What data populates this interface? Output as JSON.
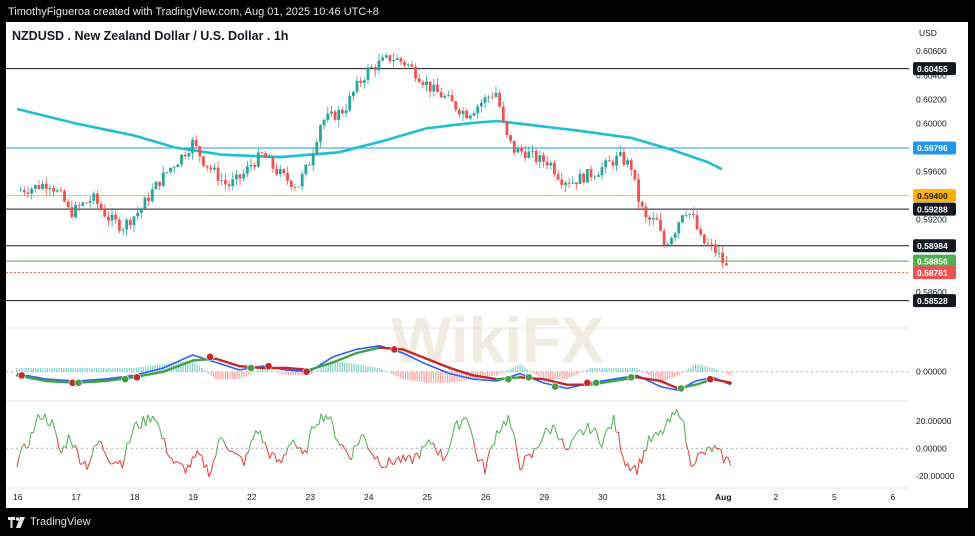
{
  "header": {
    "attribution": "TimothyFigueroa created with TradingView.com, Aug 01, 2025 10:46 UTC+8"
  },
  "chart_title": "NZDUSD . New Zealand Dollar / U.S. Dollar . 1h",
  "footer": {
    "brand": "TradingView"
  },
  "watermark": {
    "text": "WikiFX"
  },
  "colors": {
    "up": "#26a69a",
    "down": "#ef5350",
    "ma": "#1fbfcf",
    "macd_line": "#2962ff",
    "signal_line": "#c62828",
    "signal_up": "#43a047",
    "osc_up": "#4caf50",
    "osc_down": "#e53935",
    "res_black": "#131722",
    "res_blue": "#2196f3",
    "res_orange": "#ffb300",
    "res_green": "#4caf50",
    "res_red": "#ef5350"
  },
  "chart_data": [
    {
      "type": "candlestick",
      "title": "NZDUSD . New Zealand Dollar / U.S. Dollar . 1h",
      "yunit": "USD",
      "ylim": [
        0.5845,
        0.6066
      ],
      "yticks": [
        "0.60600",
        "0.60400",
        "0.60200",
        "0.60000",
        "0.59600",
        "0.59200",
        "0.58600"
      ],
      "xticks": [
        "16",
        "17",
        "18",
        "19",
        "22",
        "23",
        "24",
        "25",
        "26",
        "29",
        "30",
        "31",
        "Aug",
        "2",
        "5",
        "6"
      ],
      "price_path": [
        [
          0.0,
          0.5944
        ],
        [
          0.3,
          0.5947
        ],
        [
          0.55,
          0.5951
        ],
        [
          0.8,
          0.5936
        ],
        [
          0.9,
          0.5925
        ],
        [
          1.1,
          0.5932
        ],
        [
          1.3,
          0.5938
        ],
        [
          1.55,
          0.5922
        ],
        [
          1.8,
          0.5914
        ],
        [
          2.1,
          0.5928
        ],
        [
          2.4,
          0.595
        ],
        [
          2.6,
          0.5962
        ],
        [
          2.8,
          0.5972
        ],
        [
          3.0,
          0.5984
        ],
        [
          3.2,
          0.5968
        ],
        [
          3.4,
          0.5958
        ],
        [
          3.6,
          0.5948
        ],
        [
          3.85,
          0.5956
        ],
        [
          4.0,
          0.5966
        ],
        [
          4.2,
          0.5974
        ],
        [
          4.4,
          0.5962
        ],
        [
          4.6,
          0.5954
        ],
        [
          4.8,
          0.5948
        ],
        [
          5.0,
          0.5968
        ],
        [
          5.2,
          0.6002
        ],
        [
          5.4,
          0.6006
        ],
        [
          5.6,
          0.6012
        ],
        [
          5.8,
          0.603
        ],
        [
          6.0,
          0.6044
        ],
        [
          6.2,
          0.605
        ],
        [
          6.4,
          0.6055
        ],
        [
          6.55,
          0.6052
        ],
        [
          6.7,
          0.6048
        ],
        [
          6.9,
          0.6038
        ],
        [
          7.1,
          0.6028
        ],
        [
          7.3,
          0.6022
        ],
        [
          7.5,
          0.6014
        ],
        [
          7.7,
          0.6008
        ],
        [
          7.9,
          0.6016
        ],
        [
          8.1,
          0.6024
        ],
        [
          8.2,
          0.6026
        ],
        [
          8.35,
          0.599
        ],
        [
          8.5,
          0.5978
        ],
        [
          8.7,
          0.5976
        ],
        [
          8.9,
          0.597
        ],
        [
          9.1,
          0.5968
        ],
        [
          9.3,
          0.5954
        ],
        [
          9.5,
          0.5952
        ],
        [
          9.7,
          0.5956
        ],
        [
          9.9,
          0.596
        ],
        [
          10.1,
          0.5966
        ],
        [
          10.3,
          0.5972
        ],
        [
          10.5,
          0.5964
        ],
        [
          10.6,
          0.594
        ],
        [
          10.75,
          0.592
        ],
        [
          10.95,
          0.5918
        ],
        [
          11.05,
          0.5898
        ],
        [
          11.25,
          0.5912
        ],
        [
          11.4,
          0.593
        ],
        [
          11.55,
          0.5922
        ],
        [
          11.7,
          0.5902
        ],
        [
          11.9,
          0.5896
        ],
        [
          12.0,
          0.589
        ],
        [
          12.15,
          0.5878
        ]
      ],
      "moving_average": [
        [
          0.0,
          0.6012
        ],
        [
          1.0,
          0.6
        ],
        [
          2.0,
          0.599
        ],
        [
          2.7,
          0.598
        ],
        [
          3.5,
          0.5974
        ],
        [
          4.5,
          0.5972
        ],
        [
          5.5,
          0.5976
        ],
        [
          6.3,
          0.5986
        ],
        [
          7.0,
          0.5996
        ],
        [
          7.7,
          0.6
        ],
        [
          8.2,
          0.6002
        ],
        [
          8.9,
          0.5998
        ],
        [
          9.6,
          0.5994
        ],
        [
          10.5,
          0.5988
        ],
        [
          11.2,
          0.5978
        ],
        [
          11.8,
          0.5968
        ],
        [
          12.05,
          0.5962
        ]
      ],
      "horizontal_levels": [
        {
          "price": 0.60455,
          "label": "0.60455",
          "color_key": "res_black"
        },
        {
          "price": 0.59796,
          "label": "0.59796",
          "color_key": "res_blue"
        },
        {
          "price": 0.594,
          "label": "0.59400",
          "color_key": "res_orange"
        },
        {
          "price": 0.59288,
          "label": "0.59288",
          "color_key": "res_black"
        },
        {
          "price": 0.58984,
          "label": "0.58984",
          "color_key": "res_black"
        },
        {
          "price": 0.58856,
          "label": "0.58856",
          "color_key": "res_green"
        },
        {
          "price": 0.58761,
          "label": "0.58761",
          "color_key": "res_red"
        },
        {
          "price": 0.58528,
          "label": "0.58528",
          "color_key": "res_black"
        }
      ]
    },
    {
      "type": "line",
      "indicator": "MACD",
      "ylim": [
        -0.0012,
        0.0016
      ],
      "yticks": [
        "0.00000"
      ],
      "macd": [
        [
          0.0,
          -0.0001
        ],
        [
          0.5,
          -0.0004
        ],
        [
          1.0,
          -0.0005
        ],
        [
          1.5,
          -0.0004
        ],
        [
          2.0,
          -0.0002
        ],
        [
          2.5,
          0.0002
        ],
        [
          3.0,
          0.0009
        ],
        [
          3.4,
          0.0005
        ],
        [
          3.8,
          0.0001
        ],
        [
          4.2,
          0.0003
        ],
        [
          4.6,
          0.0001
        ],
        [
          5.0,
          0.0
        ],
        [
          5.4,
          0.0008
        ],
        [
          5.8,
          0.0012
        ],
        [
          6.2,
          0.0014
        ],
        [
          6.6,
          0.001
        ],
        [
          7.0,
          0.0004
        ],
        [
          7.4,
          -0.0001
        ],
        [
          7.8,
          -0.0004
        ],
        [
          8.2,
          -0.0005
        ],
        [
          8.6,
          -0.0001
        ],
        [
          9.0,
          -0.0006
        ],
        [
          9.4,
          -0.0009
        ],
        [
          9.8,
          -0.0006
        ],
        [
          10.2,
          -0.0004
        ],
        [
          10.6,
          -0.0002
        ],
        [
          11.0,
          -0.0008
        ],
        [
          11.3,
          -0.001
        ],
        [
          11.6,
          -0.0005
        ],
        [
          11.9,
          -0.0003
        ],
        [
          12.2,
          -0.0007
        ]
      ],
      "signal": [
        [
          0.0,
          -0.0002
        ],
        [
          0.5,
          -0.0005
        ],
        [
          1.0,
          -0.0006
        ],
        [
          1.5,
          -0.0005
        ],
        [
          2.0,
          -0.0003
        ],
        [
          2.5,
          0.0
        ],
        [
          3.0,
          0.0006
        ],
        [
          3.4,
          0.0007
        ],
        [
          3.8,
          0.0003
        ],
        [
          4.2,
          0.0002
        ],
        [
          4.6,
          0.0002
        ],
        [
          5.0,
          0.0001
        ],
        [
          5.4,
          0.0005
        ],
        [
          5.8,
          0.001
        ],
        [
          6.2,
          0.0013
        ],
        [
          6.6,
          0.0012
        ],
        [
          7.0,
          0.0007
        ],
        [
          7.4,
          0.0002
        ],
        [
          7.8,
          -0.0002
        ],
        [
          8.2,
          -0.0004
        ],
        [
          8.6,
          -0.0003
        ],
        [
          9.0,
          -0.0004
        ],
        [
          9.4,
          -0.0007
        ],
        [
          9.8,
          -0.0007
        ],
        [
          10.2,
          -0.0005
        ],
        [
          10.6,
          -0.0003
        ],
        [
          11.0,
          -0.0005
        ],
        [
          11.3,
          -0.0009
        ],
        [
          11.6,
          -0.0007
        ],
        [
          11.9,
          -0.0004
        ],
        [
          12.2,
          -0.0006
        ]
      ],
      "cross_markers": [
        {
          "x": 0.08,
          "y": -0.0002,
          "kind": "down"
        },
        {
          "x": 0.95,
          "y": -0.0006,
          "kind": "down"
        },
        {
          "x": 1.05,
          "y": -0.0006,
          "kind": "up"
        },
        {
          "x": 1.85,
          "y": -0.0004,
          "kind": "up"
        },
        {
          "x": 2.05,
          "y": -0.0003,
          "kind": "down"
        },
        {
          "x": 3.3,
          "y": 0.0008,
          "kind": "down"
        },
        {
          "x": 4.0,
          "y": 0.0002,
          "kind": "up"
        },
        {
          "x": 4.3,
          "y": 0.0003,
          "kind": "down"
        },
        {
          "x": 4.95,
          "y": 0.0,
          "kind": "down"
        },
        {
          "x": 6.45,
          "y": 0.0012,
          "kind": "down"
        },
        {
          "x": 8.4,
          "y": -0.0004,
          "kind": "up"
        },
        {
          "x": 8.75,
          "y": -0.0003,
          "kind": "up"
        },
        {
          "x": 9.2,
          "y": -0.0008,
          "kind": "up"
        },
        {
          "x": 9.75,
          "y": -0.0006,
          "kind": "down"
        },
        {
          "x": 9.9,
          "y": -0.0006,
          "kind": "up"
        },
        {
          "x": 10.5,
          "y": -0.0003,
          "kind": "up"
        },
        {
          "x": 11.35,
          "y": -0.0009,
          "kind": "up"
        },
        {
          "x": 11.85,
          "y": -0.0004,
          "kind": "down"
        }
      ]
    },
    {
      "type": "line",
      "indicator": "oscillator",
      "ylim": [
        -26,
        30
      ],
      "yticks": [
        "20.00000",
        "0.00000",
        "-20.00000"
      ],
      "values": [
        [
          0.0,
          -10
        ],
        [
          0.2,
          5
        ],
        [
          0.4,
          25
        ],
        [
          0.6,
          18
        ],
        [
          0.75,
          -5
        ],
        [
          0.9,
          10
        ],
        [
          1.05,
          -6
        ],
        [
          1.2,
          -12
        ],
        [
          1.4,
          5
        ],
        [
          1.6,
          -8
        ],
        [
          1.8,
          -10
        ],
        [
          2.0,
          15
        ],
        [
          2.2,
          20
        ],
        [
          2.35,
          25
        ],
        [
          2.5,
          5
        ],
        [
          2.7,
          -12
        ],
        [
          2.9,
          -15
        ],
        [
          3.1,
          -5
        ],
        [
          3.3,
          -18
        ],
        [
          3.5,
          10
        ],
        [
          3.7,
          -5
        ],
        [
          3.9,
          -10
        ],
        [
          4.1,
          15
        ],
        [
          4.3,
          -3
        ],
        [
          4.5,
          -12
        ],
        [
          4.7,
          8
        ],
        [
          4.9,
          -8
        ],
        [
          5.1,
          20
        ],
        [
          5.3,
          25
        ],
        [
          5.5,
          5
        ],
        [
          5.7,
          -6
        ],
        [
          5.9,
          10
        ],
        [
          6.1,
          -5
        ],
        [
          6.3,
          -12
        ],
        [
          6.5,
          -8
        ],
        [
          6.7,
          -10
        ],
        [
          6.9,
          -3
        ],
        [
          7.1,
          5
        ],
        [
          7.3,
          -8
        ],
        [
          7.5,
          15
        ],
        [
          7.7,
          25
        ],
        [
          7.85,
          -5
        ],
        [
          8.0,
          -15
        ],
        [
          8.2,
          12
        ],
        [
          8.4,
          22
        ],
        [
          8.6,
          -12
        ],
        [
          8.8,
          -6
        ],
        [
          9.0,
          10
        ],
        [
          9.2,
          16
        ],
        [
          9.4,
          -4
        ],
        [
          9.6,
          10
        ],
        [
          9.8,
          15
        ],
        [
          10.0,
          5
        ],
        [
          10.2,
          20
        ],
        [
          10.4,
          -10
        ],
        [
          10.6,
          -15
        ],
        [
          10.8,
          5
        ],
        [
          11.0,
          10
        ],
        [
          11.2,
          22
        ],
        [
          11.35,
          28
        ],
        [
          11.5,
          -10
        ],
        [
          11.7,
          -5
        ],
        [
          11.9,
          0
        ],
        [
          12.1,
          -8
        ],
        [
          12.2,
          -10
        ]
      ]
    }
  ]
}
